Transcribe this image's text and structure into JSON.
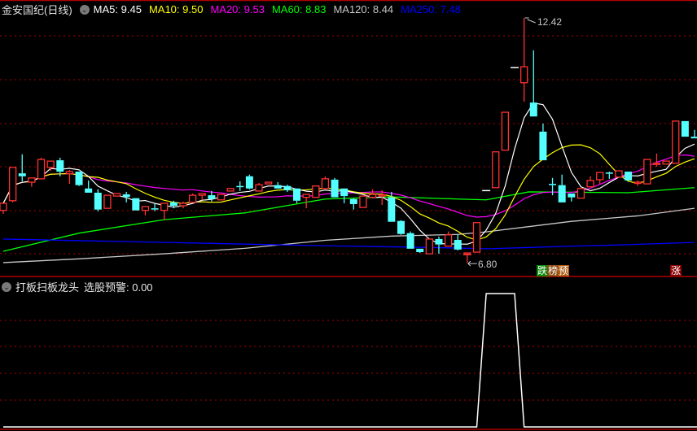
{
  "header": {
    "title": "金安国纪(日线)",
    "ma": [
      {
        "label": "MA5: 9.45",
        "color": "#ffffff"
      },
      {
        "label": "MA10: 9.50",
        "color": "#ffff00"
      },
      {
        "label": "MA20: 9.53",
        "color": "#ff00ff"
      },
      {
        "label": "MA60: 8.83",
        "color": "#00ff00"
      },
      {
        "label": "MA120: 8.44",
        "color": "#c8c8c8"
      },
      {
        "label": "MA250: 7.48",
        "color": "#0000ff"
      }
    ]
  },
  "indicator": {
    "title": "打板扫板龙头",
    "label": "选股预警: 0.00"
  },
  "markers": {
    "high": "12.42",
    "low": "6.80",
    "tag1": [
      "跌",
      "榜",
      "预"
    ],
    "tag2": "涨"
  },
  "colors": {
    "up": "#ff3232",
    "down": "#54ffff",
    "grid": "#b00000"
  },
  "chart_data": [
    {
      "type": "candlestick",
      "title": "金安国纪(日线)",
      "ylim": [
        6.8,
        12.42
      ],
      "candles_ohlc": [
        [
          7.85,
          8.02,
          7.77,
          8.02
        ],
        [
          8.08,
          8.87,
          8.04,
          8.87
        ],
        [
          8.73,
          9.18,
          8.54,
          8.66
        ],
        [
          8.52,
          8.62,
          8.41,
          8.62
        ],
        [
          8.6,
          9.1,
          8.6,
          9.06
        ],
        [
          8.87,
          9.02,
          8.79,
          9.02
        ],
        [
          9.04,
          9.1,
          8.66,
          8.77
        ],
        [
          8.72,
          8.81,
          8.48,
          8.77
        ],
        [
          8.77,
          8.77,
          8.43,
          8.45
        ],
        [
          8.37,
          8.56,
          8.27,
          8.27
        ],
        [
          8.27,
          8.35,
          7.83,
          7.87
        ],
        [
          7.9,
          8.21,
          7.9,
          8.21
        ],
        [
          8.19,
          8.25,
          8.19,
          8.25
        ],
        [
          8.23,
          8.29,
          8.04,
          8.17
        ],
        [
          8.14,
          8.14,
          7.85,
          7.85
        ],
        [
          7.85,
          7.94,
          7.73,
          7.94
        ],
        [
          7.9,
          8.0,
          7.83,
          7.87
        ],
        [
          7.85,
          8.02,
          7.62,
          8.02
        ],
        [
          8.04,
          8.08,
          7.9,
          7.96
        ],
        [
          7.96,
          8.06,
          7.9,
          8.02
        ],
        [
          8.04,
          8.25,
          8.04,
          8.21
        ],
        [
          8.21,
          8.25,
          8.1,
          8.25
        ],
        [
          8.21,
          8.31,
          8.06,
          8.12
        ],
        [
          8.1,
          8.23,
          8.1,
          8.23
        ],
        [
          8.31,
          8.37,
          8.31,
          8.37
        ],
        [
          8.43,
          8.54,
          8.31,
          8.42
        ],
        [
          8.66,
          8.7,
          8.35,
          8.37
        ],
        [
          8.31,
          8.5,
          8.31,
          8.46
        ],
        [
          8.48,
          8.52,
          8.48,
          8.52
        ],
        [
          8.45,
          8.52,
          8.37,
          8.37
        ],
        [
          8.43,
          8.46,
          8.29,
          8.33
        ],
        [
          8.37,
          8.37,
          8.02,
          8.08
        ],
        [
          8.16,
          8.23,
          7.9,
          8.23
        ],
        [
          8.16,
          8.43,
          8.16,
          8.43
        ],
        [
          8.37,
          8.66,
          8.37,
          8.6
        ],
        [
          8.58,
          8.62,
          8.16,
          8.16
        ],
        [
          8.37,
          8.37,
          8.02,
          8.19
        ],
        [
          8.12,
          8.14,
          7.87,
          8.0
        ],
        [
          7.92,
          8.19,
          7.92,
          8.19
        ],
        [
          8.16,
          8.35,
          8.16,
          8.23
        ],
        [
          8.21,
          8.33,
          7.98,
          8.22
        ],
        [
          8.16,
          8.29,
          7.58,
          7.58
        ],
        [
          7.6,
          7.62,
          7.27,
          7.29
        ],
        [
          7.31,
          7.35,
          6.94,
          6.94
        ],
        [
          6.94,
          6.94,
          6.84,
          6.86
        ],
        [
          6.82,
          7.17,
          6.82,
          7.17
        ],
        [
          7.17,
          7.23,
          6.82,
          7.04
        ],
        [
          7.0,
          7.35,
          7.0,
          7.27
        ],
        [
          7.15,
          7.27,
          6.9,
          6.92
        ],
        [
          6.82,
          6.84,
          6.8,
          6.84
        ],
        [
          6.86,
          7.56,
          6.86,
          7.56
        ],
        [
          8.32,
          8.32,
          8.32,
          8.32
        ],
        [
          8.39,
          9.24,
          8.39,
          9.24
        ],
        [
          9.28,
          10.18,
          9.28,
          10.18
        ],
        [
          11.24,
          11.24,
          11.24,
          11.24
        ],
        [
          10.88,
          12.42,
          10.43,
          11.26
        ],
        [
          10.41,
          11.65,
          10.08,
          10.08
        ],
        [
          9.72,
          9.91,
          9.04,
          9.04
        ],
        [
          8.48,
          8.62,
          8.21,
          8.45
        ],
        [
          8.45,
          8.7,
          8.04,
          8.04
        ],
        [
          8.25,
          8.25,
          8.06,
          8.16
        ],
        [
          8.14,
          8.37,
          8.14,
          8.37
        ],
        [
          8.41,
          8.66,
          8.41,
          8.56
        ],
        [
          8.58,
          8.75,
          8.48,
          8.75
        ],
        [
          8.75,
          8.77,
          8.6,
          8.72
        ],
        [
          8.64,
          8.79,
          8.64,
          8.79
        ],
        [
          8.77,
          8.77,
          8.56,
          8.56
        ],
        [
          8.52,
          8.56,
          8.43,
          8.52
        ],
        [
          8.48,
          9.06,
          8.48,
          9.06
        ],
        [
          8.97,
          9.2,
          8.89,
          8.97
        ],
        [
          8.95,
          9.02,
          8.95,
          9.02
        ],
        [
          8.97,
          9.97,
          8.97,
          9.97
        ],
        [
          9.97,
          9.97,
          9.6,
          9.6
        ],
        [
          9.6,
          9.76,
          9.56,
          9.56
        ]
      ],
      "ma_periods_computed": [
        5,
        10,
        20
      ],
      "ma_long": [
        {
          "name": "MA60",
          "points": [
            [
              0,
              6.88
            ],
            [
              8,
              7.31
            ],
            [
              17,
              7.63
            ],
            [
              25.5,
              7.79
            ],
            [
              34,
              8.12
            ],
            [
              41,
              8.17
            ],
            [
              48,
              8.12
            ],
            [
              51,
              8.1
            ],
            [
              55.5,
              8.29
            ],
            [
              66,
              8.27
            ],
            [
              73,
              8.39
            ]
          ]
        },
        {
          "name": "MA120",
          "points": [
            [
              0,
              6.61
            ],
            [
              8,
              6.7
            ],
            [
              17,
              6.82
            ],
            [
              25.5,
              6.95
            ],
            [
              34,
              7.14
            ],
            [
              41,
              7.24
            ],
            [
              48,
              7.28
            ],
            [
              51,
              7.34
            ],
            [
              60,
              7.59
            ],
            [
              67,
              7.72
            ],
            [
              73,
              7.9
            ]
          ]
        },
        {
          "name": "MA250",
          "points": [
            [
              0,
              7.17
            ],
            [
              25.5,
              7.05
            ],
            [
              34,
              7.01
            ],
            [
              42.7,
              6.98
            ],
            [
              51.3,
              6.94
            ],
            [
              59.9,
              7.0
            ],
            [
              65,
              7.03
            ],
            [
              73,
              7.09
            ]
          ]
        }
      ]
    },
    {
      "type": "line",
      "title": "打板扫板龙头 选股预警",
      "ylim": [
        0,
        1
      ],
      "values": [
        0,
        0,
        0,
        0,
        0,
        0,
        0,
        0,
        0,
        0,
        0,
        0,
        0,
        0,
        0,
        0,
        0,
        0,
        0,
        0,
        0,
        0,
        0,
        0,
        0,
        0,
        0,
        0,
        0,
        0,
        0,
        0,
        0,
        0,
        0,
        0,
        0,
        0,
        0,
        0,
        0,
        0,
        0,
        0,
        0,
        0,
        0,
        0,
        0,
        0,
        0,
        1,
        1,
        1,
        1,
        0,
        0,
        0,
        0,
        0,
        0,
        0,
        0,
        0,
        0,
        0,
        0,
        0,
        0,
        0,
        0,
        0,
        0,
        0
      ]
    }
  ]
}
